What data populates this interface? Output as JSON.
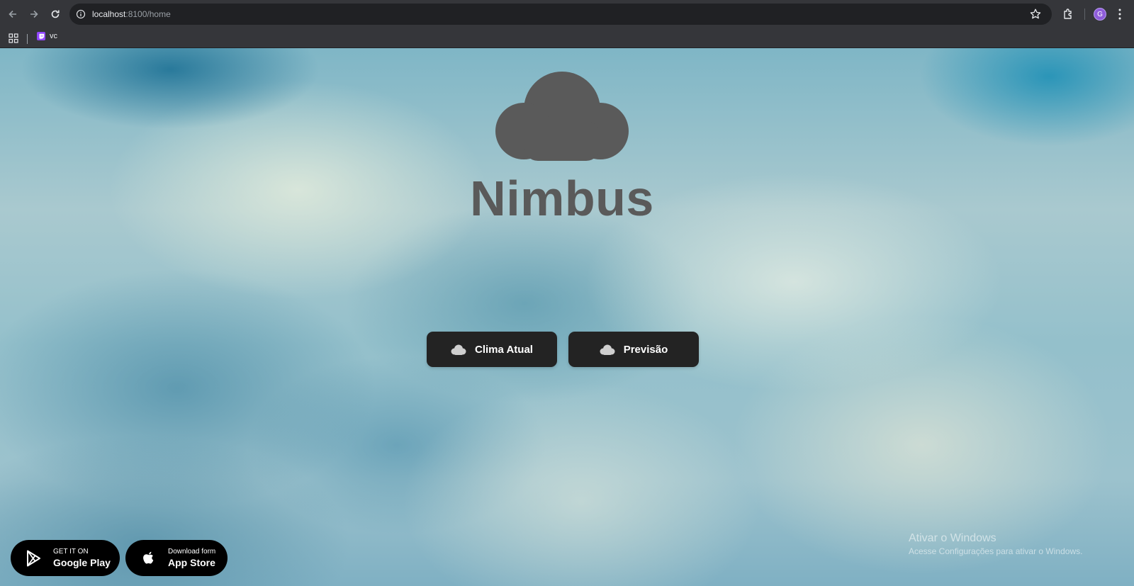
{
  "browser": {
    "url_host": "localhost",
    "url_rest": ":8100/home",
    "profile_initial": "G",
    "bookmarks": [
      {
        "label": "vc",
        "icon": "twitch-icon"
      }
    ]
  },
  "app": {
    "title": "Nimbus",
    "logo_icon": "cloud-icon",
    "buttons": {
      "current": "Clima Atual",
      "forecast": "Previsão"
    }
  },
  "stores": {
    "google": {
      "small": "GET IT ON",
      "big": "Google Play",
      "icon": "google-play-icon"
    },
    "apple": {
      "small": "Download form",
      "big": "App Store",
      "icon": "apple-icon"
    }
  },
  "watermark": {
    "title": "Ativar o Windows",
    "subtitle": "Acesse Configurações para ativar o Windows."
  },
  "colors": {
    "button_bg": "#232323",
    "title": "#5a5a5a",
    "logo": "#5a5a5a",
    "chrome": "#35363a"
  }
}
